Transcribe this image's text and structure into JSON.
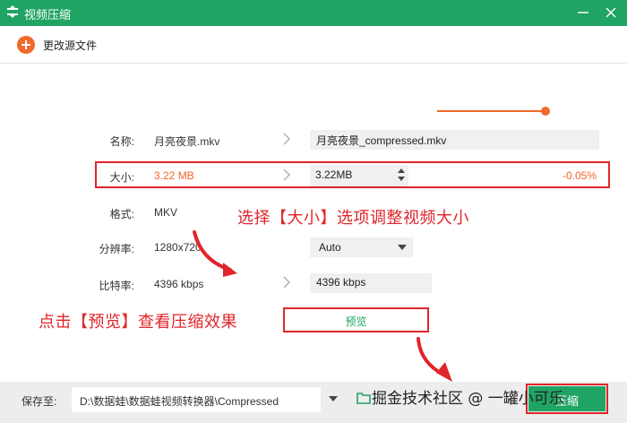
{
  "window": {
    "title": "视频压缩",
    "icons": [
      "app-icon",
      "minimize-icon",
      "close-icon"
    ]
  },
  "toolbar": {
    "change_source_label": "更改源文件",
    "icon": "plus-circle-icon"
  },
  "form": {
    "name": {
      "label": "名称:",
      "source": "月亮夜景.mkv",
      "output": "月亮夜景_compressed.mkv"
    },
    "size": {
      "label": "大小:",
      "source": "3.22 MB",
      "output": "3.22MB",
      "percent": "-0.05%",
      "slider_level": 0.95
    },
    "format": {
      "label": "格式:",
      "source": "MKV"
    },
    "resolution": {
      "label": "分辨率:",
      "source": "1280x720",
      "selected": "Auto"
    },
    "bitrate": {
      "label": "比特率:",
      "source": "4396 kbps",
      "output": "4396 kbps"
    }
  },
  "preview": {
    "label": "预览"
  },
  "annotations": {
    "size_hint": "选择【大小】选项调整视频大小",
    "preview_hint": "点击【预览】查看压缩效果"
  },
  "footer": {
    "save_label": "保存至:",
    "save_path": "D:\\数据蛙\\数据蛙视频转换器\\Compressed",
    "start_label": "压缩",
    "watermark": "掘金技术社区 @ 一罐小可乐"
  },
  "colors": {
    "brand_green": "#1fa463",
    "accent_orange": "#ef6a2c",
    "annotation_red": "#e0252a"
  }
}
